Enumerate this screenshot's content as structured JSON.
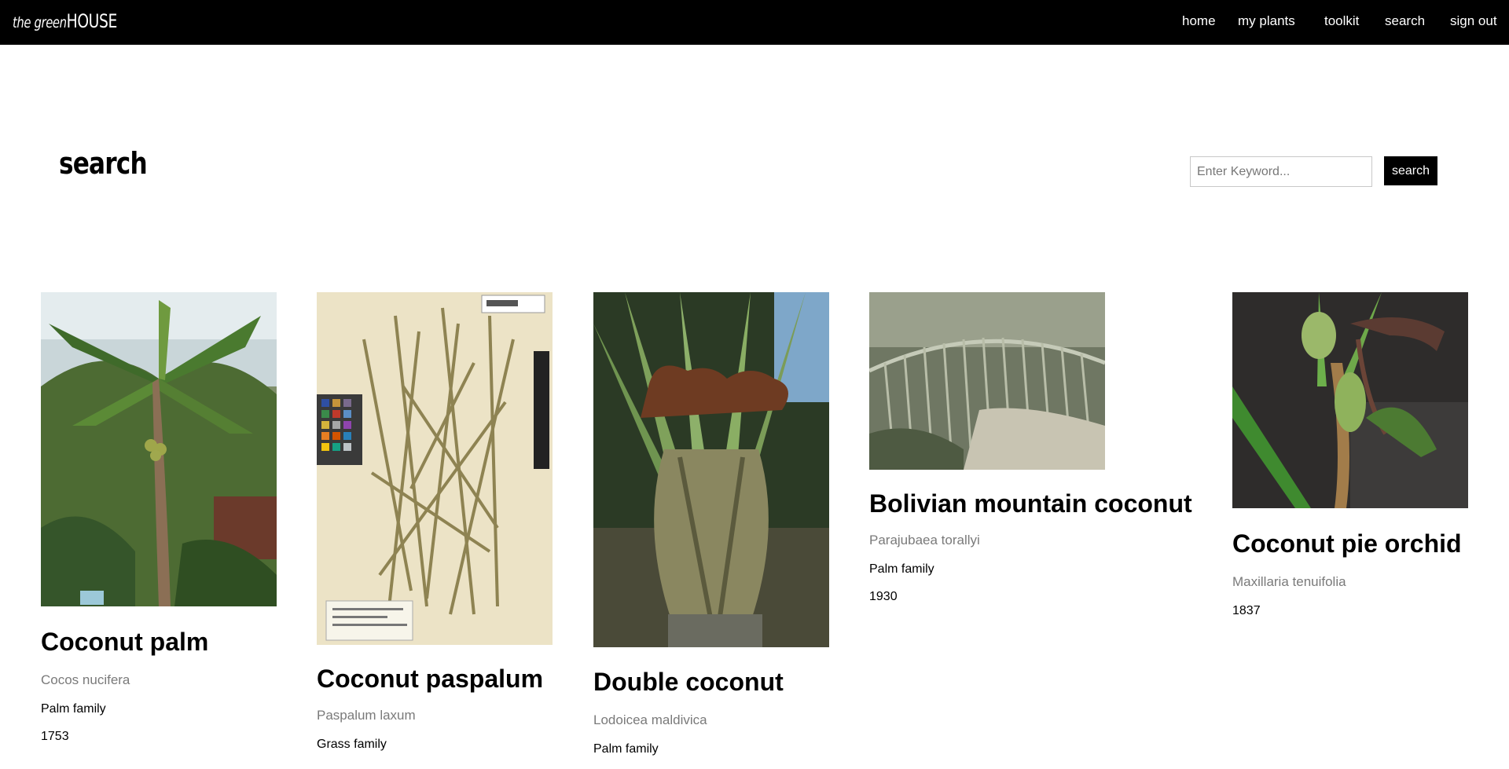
{
  "brand": {
    "prefix": "the green",
    "suffix": "HOUSE"
  },
  "nav": {
    "home": "home",
    "my_plants": "my plants",
    "toolkit": "toolkit",
    "search": "search",
    "sign_out": "sign out"
  },
  "page": {
    "title": "search"
  },
  "search": {
    "placeholder": "Enter Keyword...",
    "value": "",
    "button_label": "search"
  },
  "results": [
    {
      "name": "Coconut palm",
      "scientific": "Cocos nucifera",
      "family": "Palm family",
      "year": "1753",
      "image": "coconut-palm-photo"
    },
    {
      "name": "Coconut paspalum",
      "scientific": "Paspalum laxum",
      "family": "Grass family",
      "year": "",
      "image": "herbarium-specimen-photo"
    },
    {
      "name": "Double coconut",
      "scientific": "Lodoicea maldivica",
      "family": "Palm family",
      "year": "",
      "image": "double-coconut-photo"
    },
    {
      "name": "Bolivian mountain coconut",
      "scientific": "Parajubaea torallyi",
      "family": "Palm family",
      "year": "1930",
      "image": "palm-fronds-photo"
    },
    {
      "name": "Coconut pie orchid",
      "scientific": "Maxillaria tenuifolia",
      "family": "",
      "year": "1837",
      "image": "orchid-photo"
    }
  ],
  "colors": {
    "topbar": "#000000",
    "accent_button": "#000000",
    "muted_text": "#7a7a7a"
  }
}
